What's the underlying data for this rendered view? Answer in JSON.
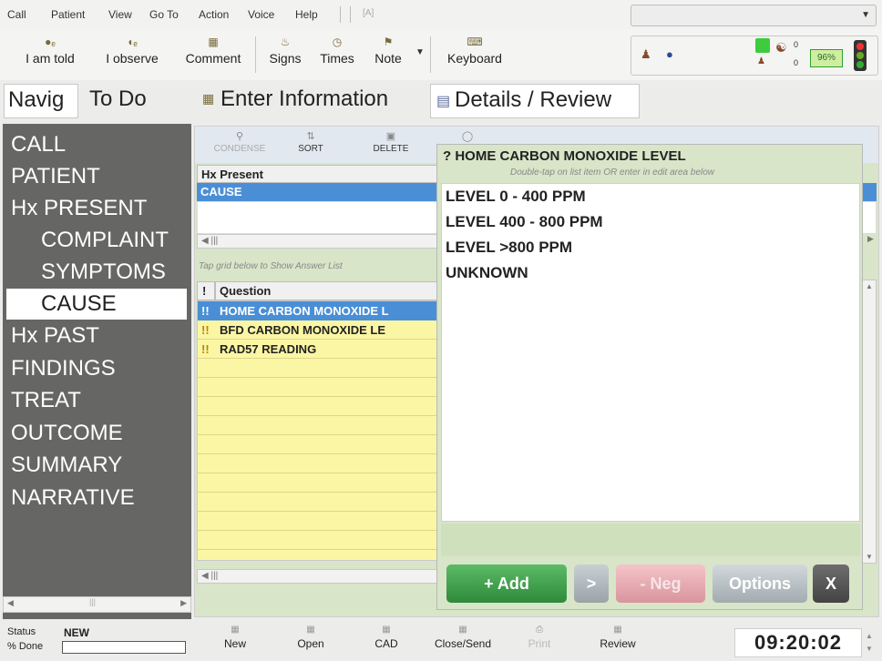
{
  "menu": {
    "items": [
      "Call",
      "Patient",
      "View",
      "Go To",
      "Action",
      "Voice",
      "Help"
    ],
    "extra": "[A]"
  },
  "toolbar": {
    "buttons": [
      "I am told",
      "I observe",
      "Comment",
      "Signs",
      "Times",
      "Note",
      "Keyboard"
    ]
  },
  "status_panel": {
    "counter_top": "0",
    "counter_bottom": "0",
    "percent": "96%"
  },
  "tabs": {
    "navig": "Navig",
    "todo": "To Do",
    "enter_info": "Enter Information",
    "details": "Details / Review"
  },
  "nav": {
    "items": [
      "CALL",
      "PATIENT",
      "Hx PRESENT",
      "COMPLAINT",
      "SYMPTOMS",
      "CAUSE",
      "Hx PAST",
      "FINDINGS",
      "TREAT",
      "OUTCOME",
      "SUMMARY",
      "NARRATIVE"
    ],
    "active": "CAUSE"
  },
  "grid_toolbar": {
    "condense": "CONDENSE",
    "sort": "SORT",
    "delete": "DELETE"
  },
  "hx_grid": {
    "header": "Hx Present",
    "selected_row": "CAUSE"
  },
  "hint": "Tap grid below to Show Answer List",
  "question_grid": {
    "bang_header": "!",
    "header": "Question",
    "rows": [
      {
        "flag": "!!",
        "text": "HOME CARBON MONOXIDE L"
      },
      {
        "flag": "!!",
        "text": "BFD CARBON MONOXIDE LE"
      },
      {
        "flag": "!!",
        "text": "RAD57 READING"
      }
    ]
  },
  "popup": {
    "title": "? HOME CARBON MONOXIDE LEVEL",
    "subtitle": "Double-tap on list item OR enter in edit area below",
    "answers": [
      "LEVEL 0 - 400 PPM",
      "LEVEL 400 - 800 PPM",
      "LEVEL >800 PPM",
      "UNKNOWN"
    ],
    "buttons": {
      "add": "+ Add",
      "next": ">",
      "neg": "- Neg",
      "options": "Options",
      "close": "X"
    },
    "colors": {
      "add": "#3e9a4a",
      "neg": "#e8a6ae",
      "options": "#b8c0c6",
      "close": "#555555"
    }
  },
  "statusbar": {
    "status_label": "Status",
    "done_label": "% Done",
    "status_value": "NEW",
    "buttons": [
      "New",
      "Open",
      "CAD",
      "Close/Send",
      "Print",
      "Review"
    ],
    "time": "09:20:02"
  }
}
